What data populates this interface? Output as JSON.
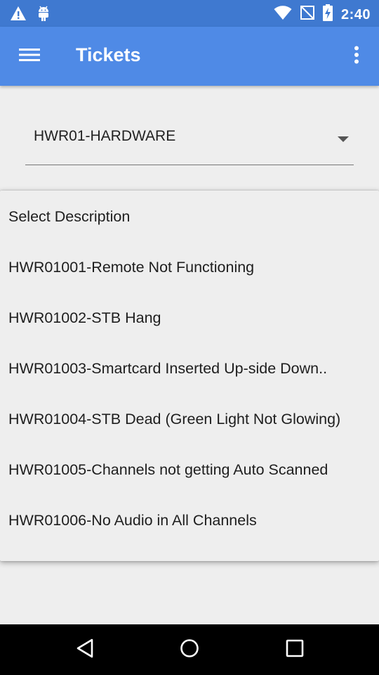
{
  "status_bar": {
    "time": "2:40",
    "icons": [
      "warning-icon",
      "android-icon",
      "wifi-icon",
      "no-signal-icon",
      "battery-charging-icon"
    ]
  },
  "app_bar": {
    "title": "Tickets",
    "icons": [
      "menu-icon",
      "more-vert-icon"
    ]
  },
  "spinner": {
    "selected": "HWR01-HARDWARE"
  },
  "dropdown": {
    "items": [
      "Select Description",
      "HWR01001-Remote Not Functioning",
      "HWR01002-STB Hang",
      "HWR01003-Smartcard Inserted Up-side Down..",
      "HWR01004-STB Dead (Green Light Not Glowing)",
      "HWR01005-Channels not getting Auto Scanned",
      "HWR01006-No Audio in All Channels"
    ]
  },
  "nav_bar": {
    "icons": [
      "back-icon",
      "home-icon",
      "recents-icon"
    ]
  },
  "colors": {
    "status_bar": "#3f79d0",
    "app_bar": "#4f8ae6",
    "background": "#eeeeee"
  }
}
